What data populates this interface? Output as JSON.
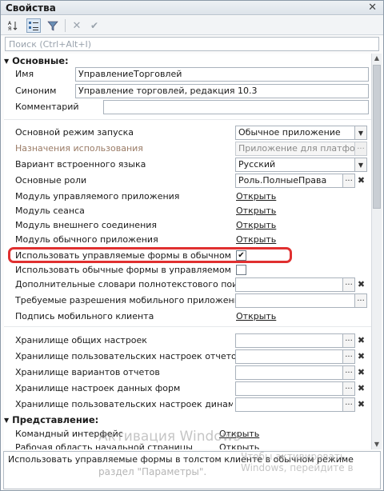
{
  "window": {
    "title": "Свойства",
    "close": "✕"
  },
  "toolbar": {
    "sort_icon": "sort-az-icon",
    "categories_icon": "categories-icon",
    "filter_icon": "filter-icon",
    "clear_icon": "cross-icon",
    "apply_icon": "check-icon"
  },
  "search": {
    "placeholder": "Поиск (Ctrl+Alt+I)"
  },
  "groups": {
    "main": "Основные:",
    "presentation": "Представление:"
  },
  "props": {
    "name": {
      "label": "Имя",
      "value": "УправлениеТорговлей"
    },
    "synonym": {
      "label": "Синоним",
      "value": "Управление торговлей, редакция 10.3"
    },
    "comment": {
      "label": "Комментарий",
      "value": ""
    },
    "run_mode": {
      "label": "Основной режим запуска",
      "value": "Обычное приложение"
    },
    "usage_purpose": {
      "label": "Назначения использования",
      "value": "Приложение для платформы"
    },
    "script_variant": {
      "label": "Вариант встроенного языка",
      "value": "Русский"
    },
    "main_roles": {
      "label": "Основные роли",
      "value": "Роль.ПолныеПрава"
    },
    "managed_app_module": {
      "label": "Модуль управляемого приложения",
      "value": "Открыть"
    },
    "session_module": {
      "label": "Модуль сеанса",
      "value": "Открыть"
    },
    "ext_conn_module": {
      "label": "Модуль внешнего соединения",
      "value": "Открыть"
    },
    "ordinary_app_module": {
      "label": "Модуль обычного приложения",
      "value": "Открыть"
    },
    "use_managed_forms": {
      "label": "Использовать управляемые формы в обычном прило",
      "checked": "✔"
    },
    "use_ordinary_forms": {
      "label": "Использовать обычные формы в управляемом прило",
      "checked": ""
    },
    "fulltext_dicts": {
      "label": "Дополнительные словари полнотекстового поиска",
      "value": ""
    },
    "mobile_permissions": {
      "label": "Требуемые разрешения мобильного приложения",
      "value": ""
    },
    "mobile_signature": {
      "label": "Подпись мобильного клиента",
      "value": "Открыть"
    },
    "common_settings": {
      "label": "Хранилище общих настроек",
      "value": ""
    },
    "report_user_settings": {
      "label": "Хранилище пользовательских настроек отчетов",
      "value": ""
    },
    "report_variants": {
      "label": "Хранилище вариантов отчетов",
      "value": ""
    },
    "form_data_settings": {
      "label": "Хранилище настроек данных форм",
      "value": ""
    },
    "dynamic_user_settings": {
      "label": "Хранилище пользовательских настроек динамическ",
      "value": ""
    },
    "command_interface": {
      "label": "Командный интерфейс",
      "value": "Открыть"
    },
    "home_work_area": {
      "label": "Рабочая область начальной страницы",
      "value": "Открыть"
    }
  },
  "description": "Использовать управляемые формы в толстом клиенте в обычном режиме",
  "watermark": {
    "line1": "Активация Windows",
    "line2": "Чтобы активировать Windows, перейдите в",
    "line3": "раздел \"Параметры\"."
  }
}
